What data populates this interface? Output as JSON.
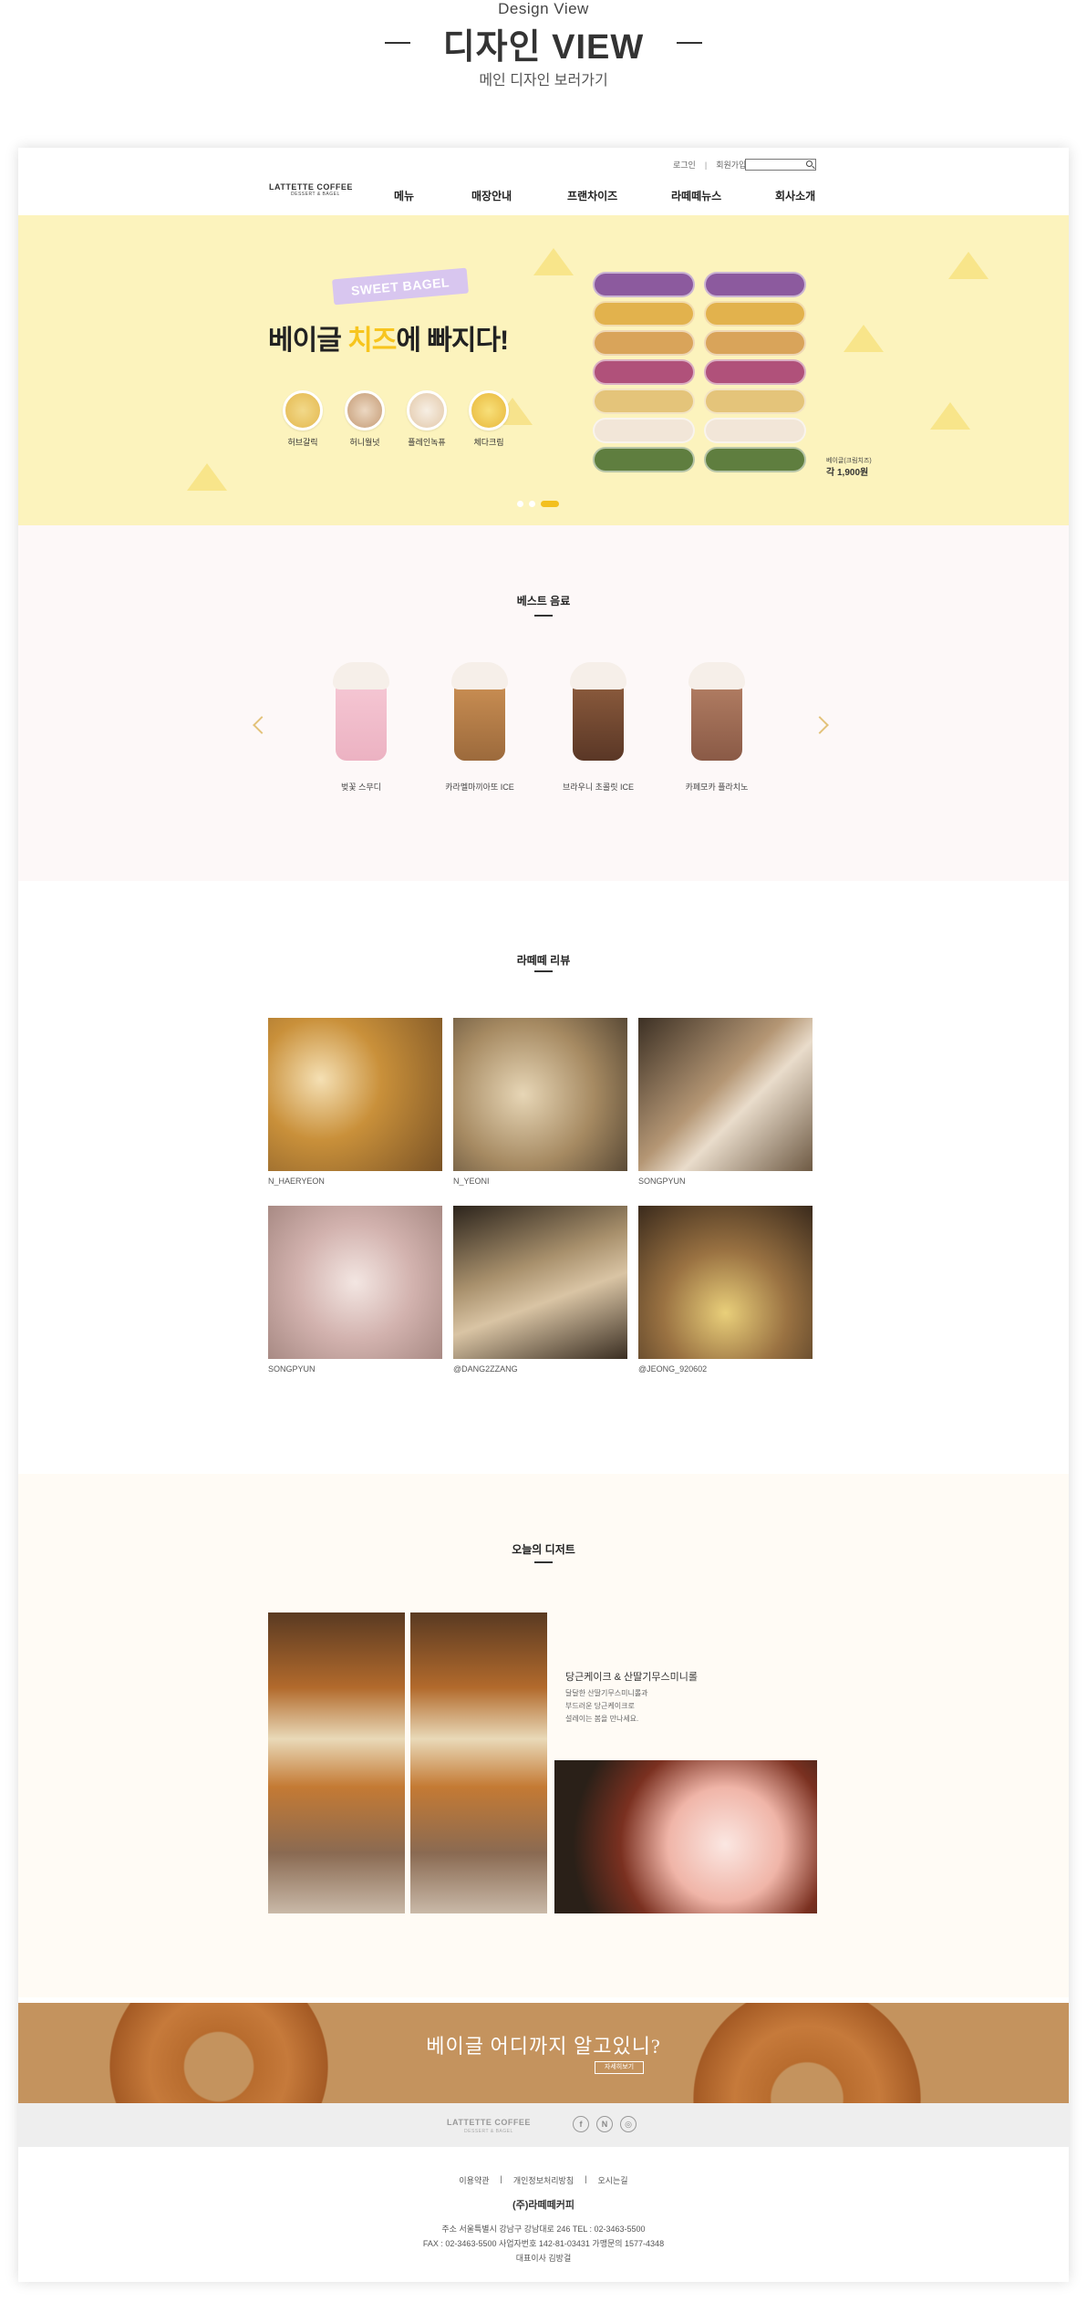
{
  "presentation": {
    "eyebrow": "Design View",
    "title": "디자인 VIEW",
    "subtitle": "메인 디자인 보러가기"
  },
  "header": {
    "login": "로그인",
    "join": "회원가입",
    "logo_top": "LATTETTE COFFEE",
    "logo_sub": "DESSERT & BAGEL",
    "nav": [
      "메뉴",
      "매장안내",
      "프랜차이즈",
      "라떼떼뉴스",
      "회사소개"
    ]
  },
  "hero": {
    "tag": "SWEET BAGEL",
    "title_pre": "베이글 ",
    "title_highlight": "치즈",
    "title_post": "에 빠지다!",
    "flavors": [
      "허브갈릭",
      "허니월넛",
      "플레인녹퓨",
      "체다크림"
    ],
    "price_caption": "베이글(크림치즈)",
    "price": "각 1,900원",
    "slides": 3,
    "active_slide": 3,
    "colors": {
      "background": "#fcf3bd",
      "highlight": "#f7c51e"
    }
  },
  "best": {
    "title": "베스트 음료",
    "items": [
      "벚꽃 스무디",
      "카라멜마끼아또 ICE",
      "브라우니 초콜릿 ICE",
      "카페모카 플라치노"
    ]
  },
  "reviews": {
    "title": "라떼떼 리뷰",
    "items": [
      "N_HAERYEON",
      "N_YEONI",
      "SONGPYUN",
      "SONGPYUN",
      "@DANG2ZZANG",
      "@JEONG_920602"
    ]
  },
  "dessert": {
    "title": "오늘의 디저트",
    "item_title": "당근케이크 & 산딸기무스미니롤",
    "item_desc": [
      "달달한 산딸기무스미니롤과",
      "부드러운 당근케이크로",
      "설레이는 봄을 만나세요."
    ]
  },
  "banner": {
    "title": "베이글 어디까지 알고있니?",
    "button": "자세히보기"
  },
  "footer": {
    "logo": "LATTETTE COFFEE",
    "logo_sub": "DESSERT & BAGEL",
    "sns": [
      "f",
      "N",
      "◎"
    ],
    "links": [
      "이용약관",
      "개인정보처리방침",
      "오시는길"
    ],
    "company": "(주)라떼떼커피",
    "address": "주소 서울특별시 강남구 강남대로 246   TEL : 02-3463-5500",
    "fax_line": "FAX : 02-3463-5500    사업자번호 142-81-03431    가맹문의 1577-4348",
    "ceo": "대표이사 김방걸"
  }
}
